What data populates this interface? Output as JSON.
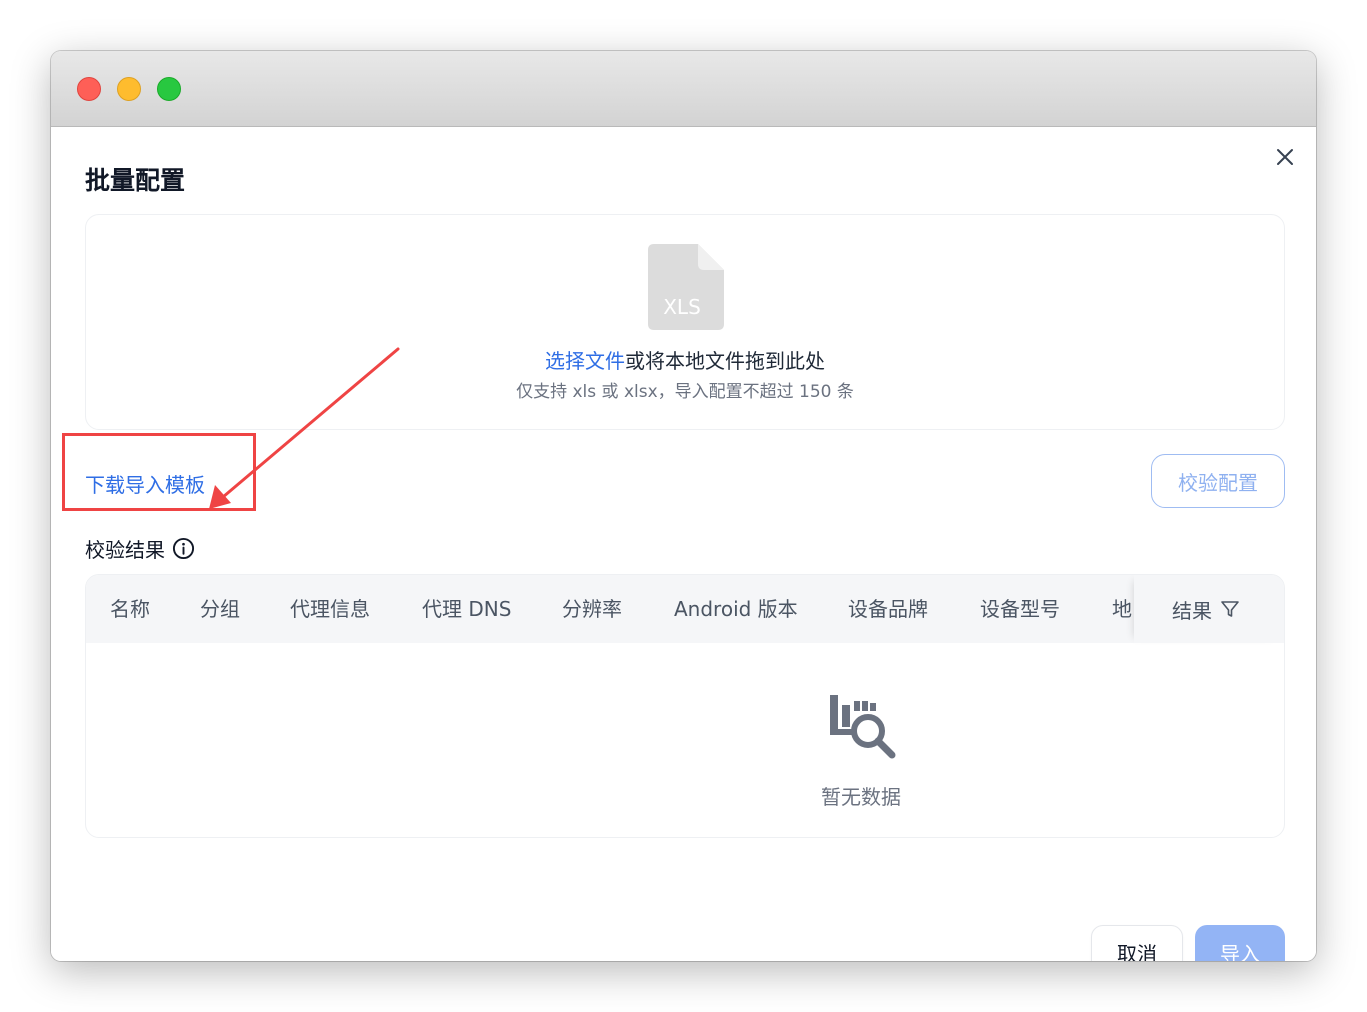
{
  "dialog": {
    "title": "批量配置"
  },
  "upload": {
    "file_badge": "XLS",
    "select_link": "选择文件",
    "drag_text": "或将本地文件拖到此处",
    "hint": "仅支持 xls 或 xlsx，导入配置不超过 150 条"
  },
  "download_template": "下载导入模板",
  "verify_button": "校验配置",
  "result_label": "校验结果",
  "table": {
    "columns": [
      "名称",
      "分组",
      "代理信息",
      "代理 DNS",
      "分辨率",
      "Android 版本",
      "设备品牌",
      "设备型号",
      "地"
    ],
    "result_column": "结果",
    "empty_text": "暂无数据"
  },
  "footer": {
    "cancel": "取消",
    "import": "导入"
  },
  "colors": {
    "link": "#2f6ee5",
    "highlight": "#ef4444",
    "primary_disabled": "#93b4f5"
  }
}
